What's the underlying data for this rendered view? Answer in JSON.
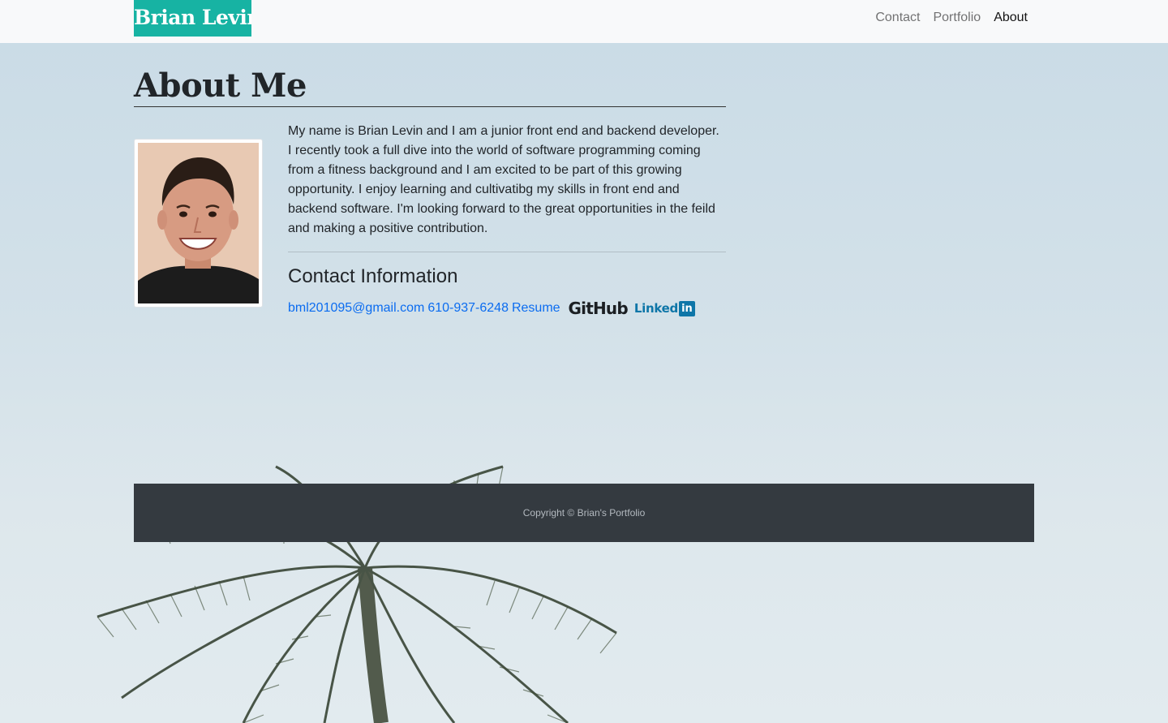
{
  "navbar": {
    "brand": "Brian Levin",
    "links": [
      {
        "label": "Contact",
        "active": false
      },
      {
        "label": "Portfolio",
        "active": false
      },
      {
        "label": "About",
        "active": true
      }
    ]
  },
  "main": {
    "title": "About Me",
    "bio": "My name is Brian Levin and I am a junior front end and backend developer. I recently took a full dive into the world of software programming coming from a fitness background and I am excited to be part of this growing opportunity. I enjoy learning and cultivatibg my skills in front end and backend software. I'm looking forward to the great opportunities in the feild and making a positive contribution.",
    "contact_heading": "Contact Information",
    "contact": {
      "email": "bml201095@gmail.com",
      "phone": "610-937-6248",
      "resume": "Resume",
      "github_logo": "GitHub",
      "linkedin_text": "Linked",
      "linkedin_box": "in"
    },
    "photo_icon": "profile-photo"
  },
  "footer": {
    "text": "Copyright © Brian's Portfolio"
  },
  "colors": {
    "brand_bg": "#17b3a3",
    "link": "#0b6cf0",
    "footer_bg": "#343a40",
    "navbar_bg": "#f8f9fa"
  }
}
